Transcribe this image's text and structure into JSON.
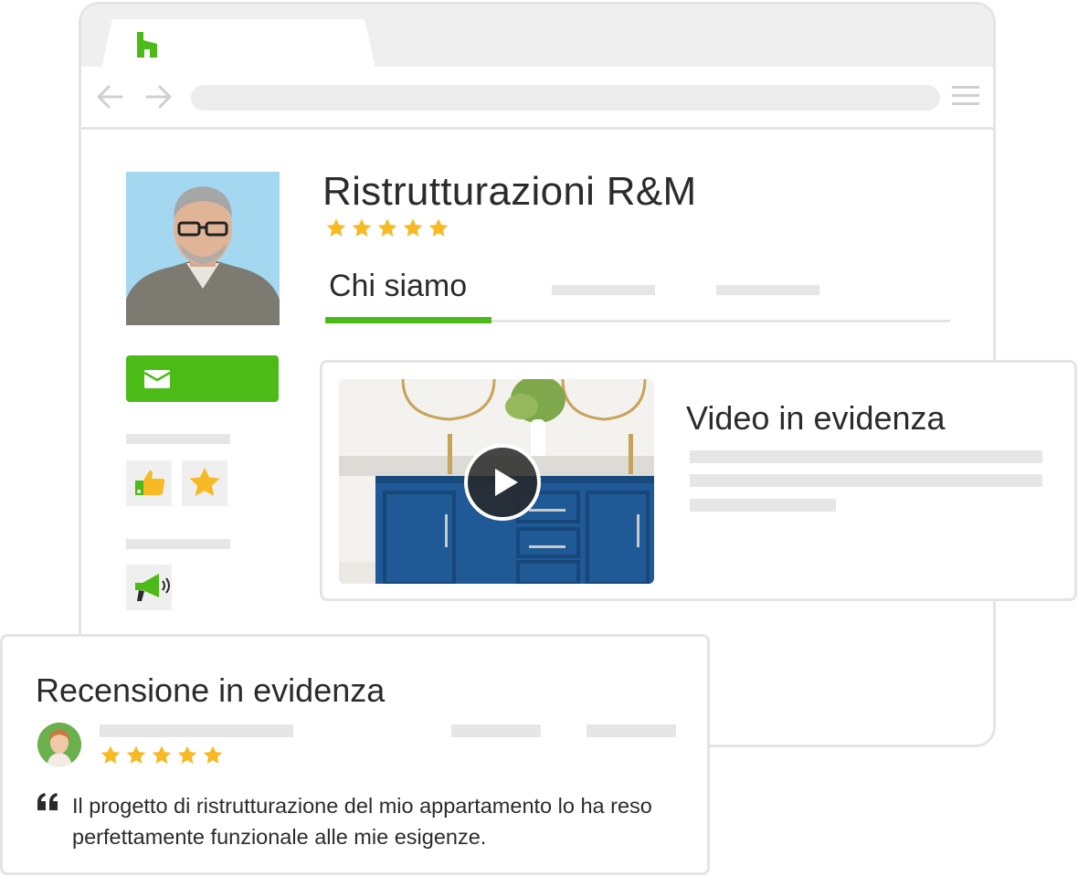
{
  "browser": {
    "logo_icon": "houzz-logo-icon",
    "brand_color": "#4cbb17"
  },
  "profile": {
    "company_name": "Ristrutturazioni R&M",
    "rating_stars": 5,
    "tabs": [
      {
        "label": "Chi siamo",
        "active": true
      }
    ],
    "contact_icon": "envelope-icon",
    "badges": [
      "thumbs-up-icon",
      "star-icon"
    ],
    "promo_icon": "megaphone-icon"
  },
  "video_card": {
    "title": "Video in evidenza",
    "play_icon": "play-icon"
  },
  "review_card": {
    "title": "Recensione in evidenza",
    "rating_stars": 5,
    "text": "Il progetto di ristrutturazione del mio appartamento lo ha reso perfettamente funzionale alle mie esigenze."
  },
  "colors": {
    "star": "#f7b924",
    "placeholder": "#e6e6e6",
    "border": "#e4e4e4"
  }
}
